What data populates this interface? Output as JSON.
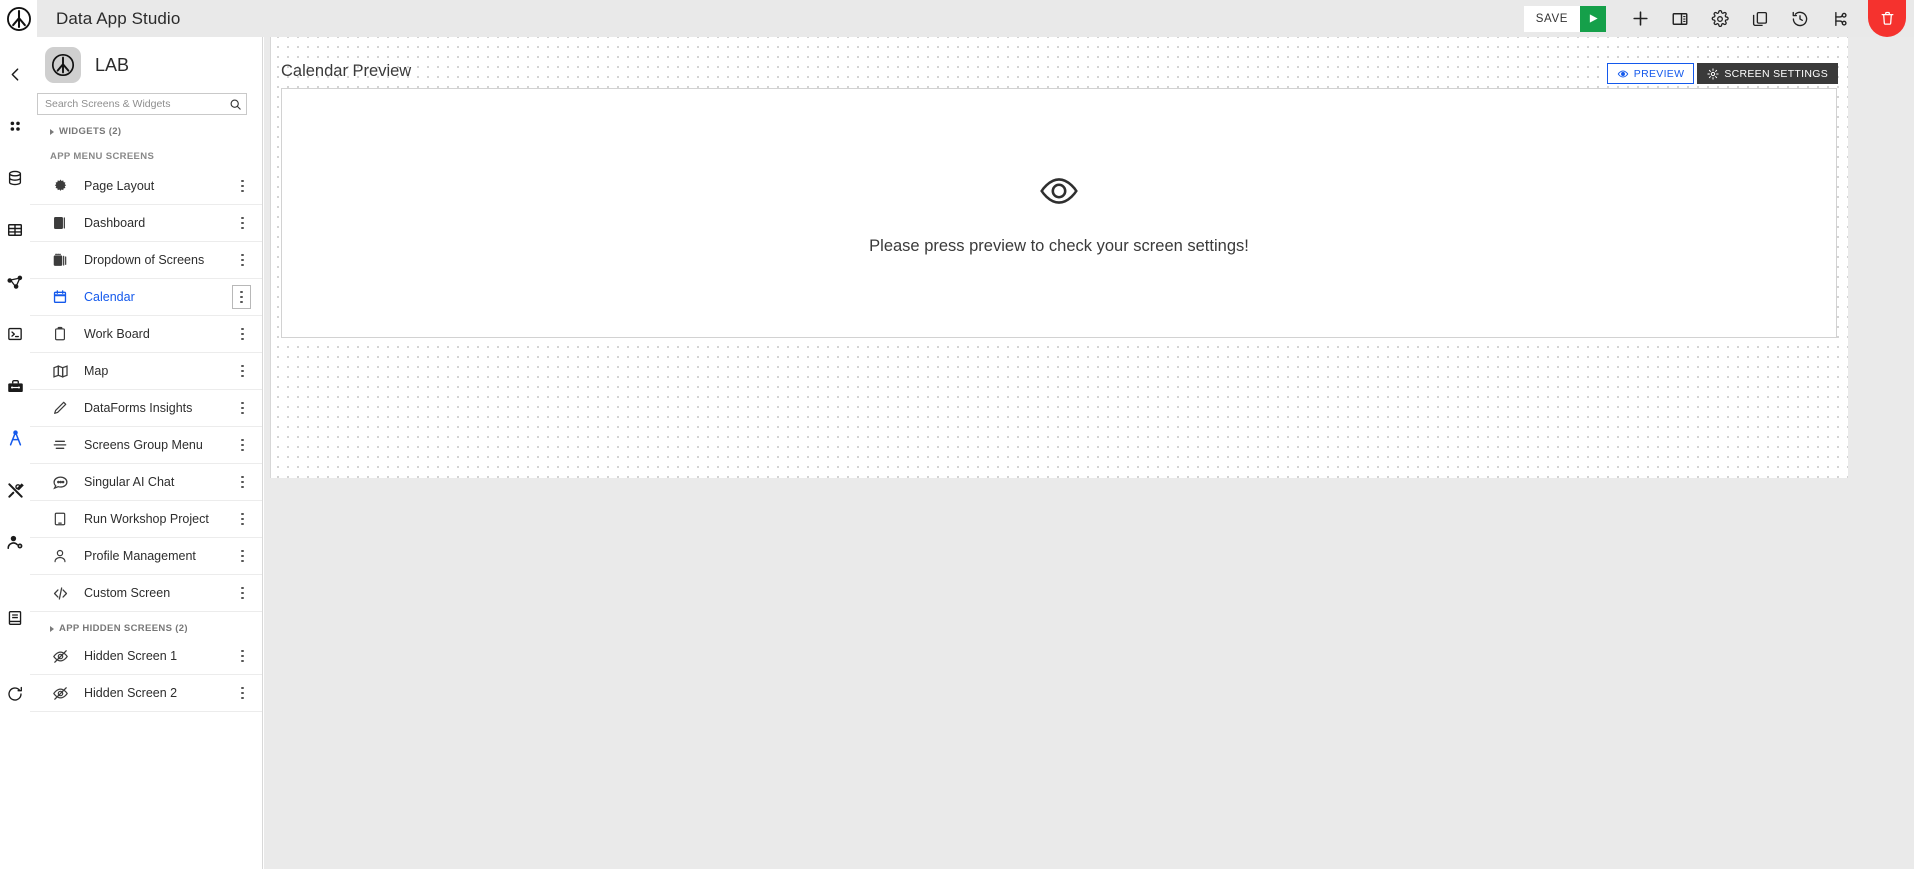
{
  "topbar": {
    "logo_icon": "app-logo-icon",
    "title": "Data App Studio",
    "save_label": "SAVE",
    "run_icon": "play-icon",
    "actions": [
      {
        "name": "add-button",
        "icon": "plus-icon"
      },
      {
        "name": "panel-layout-button",
        "icon": "panel-layout-icon"
      },
      {
        "name": "settings-button",
        "icon": "gear-icon"
      },
      {
        "name": "duplicate-button",
        "icon": "copy-icon"
      },
      {
        "name": "history-button",
        "icon": "history-clock-icon"
      },
      {
        "name": "branch-button",
        "icon": "git-branch-icon"
      }
    ],
    "delete_icon": "trash-icon",
    "accent_green": "#15a04a",
    "accent_red": "#f5322e"
  },
  "rail": {
    "items": [
      {
        "name": "collapse-rail",
        "icon": "chevron-left-icon",
        "active": false
      },
      {
        "name": "rail-item-apps",
        "icon": "four-dots-icon",
        "active": false
      },
      {
        "name": "rail-item-database",
        "icon": "database-icon",
        "active": false
      },
      {
        "name": "rail-item-table",
        "icon": "table-grid-icon",
        "active": false
      },
      {
        "name": "rail-item-graph",
        "icon": "network-graph-icon",
        "active": false
      },
      {
        "name": "rail-item-terminal",
        "icon": "terminal-icon",
        "active": false
      },
      {
        "name": "rail-item-toolbox",
        "icon": "toolbox-icon",
        "active": false
      },
      {
        "name": "rail-item-designer",
        "icon": "compass-icon",
        "active": true
      },
      {
        "name": "rail-item-tools",
        "icon": "screwdriver-wrench-icon",
        "active": false
      },
      {
        "name": "rail-item-user-admin",
        "icon": "user-gear-icon",
        "active": false
      },
      {
        "name": "rail-item-docs",
        "icon": "book-icon",
        "active": false
      },
      {
        "name": "rail-item-refresh",
        "icon": "refresh-icon",
        "active": false
      }
    ],
    "active_color": "#1459ec"
  },
  "sidebar": {
    "workspace_name": "LAB",
    "workspace_logo_icon": "app-logo-icon",
    "search": {
      "placeholder": "Search Screens & Widgets",
      "value": "",
      "icon": "search-icon"
    },
    "widgets_section": {
      "label": "WIDGETS (2)",
      "count": 2,
      "collapsed": true
    },
    "app_menu_label": "APP MENU SCREENS",
    "screens": [
      {
        "label": "Page Layout",
        "icon": "gear-burst-icon",
        "selected": false
      },
      {
        "label": "Dashboard",
        "icon": "dashboard-icon",
        "selected": false
      },
      {
        "label": "Dropdown of Screens",
        "icon": "dropdown-stack-icon",
        "selected": false
      },
      {
        "label": "Calendar",
        "icon": "calendar-icon",
        "selected": true
      },
      {
        "label": "Work Board",
        "icon": "clipboard-icon",
        "selected": false
      },
      {
        "label": "Map",
        "icon": "map-icon",
        "selected": false
      },
      {
        "label": "DataForms Insights",
        "icon": "pencil-icon",
        "selected": false
      },
      {
        "label": "Screens Group Menu",
        "icon": "menu-lines-icon",
        "selected": false
      },
      {
        "label": "Singular AI Chat",
        "icon": "chat-bubble-icon",
        "selected": false
      },
      {
        "label": "Run Workshop Project",
        "icon": "tablet-icon",
        "selected": false
      },
      {
        "label": "Profile Management",
        "icon": "user-icon",
        "selected": false
      },
      {
        "label": "Custom Screen",
        "icon": "code-tags-icon",
        "selected": false
      }
    ],
    "hidden_section": {
      "label": "APP HIDDEN SCREENS (2)",
      "count": 2,
      "collapsed": true
    },
    "hidden_screens": [
      {
        "label": "Hidden Screen 1",
        "icon": "eye-off-icon"
      },
      {
        "label": "Hidden Screen 2",
        "icon": "eye-off-icon"
      }
    ],
    "row_menu_icon": "kebab-menu-icon",
    "selected_color": "#1459ec"
  },
  "canvas": {
    "board_title": "Calendar Preview",
    "preview_button": {
      "label": "PREVIEW",
      "icon": "eye-icon",
      "color": "#1459ec"
    },
    "settings_button": {
      "label": "SCREEN SETTINGS",
      "icon": "gear-icon",
      "color": "#3a3a3a"
    },
    "empty_state": {
      "icon": "eye-icon",
      "message": "Please press preview to check your screen settings!"
    }
  }
}
